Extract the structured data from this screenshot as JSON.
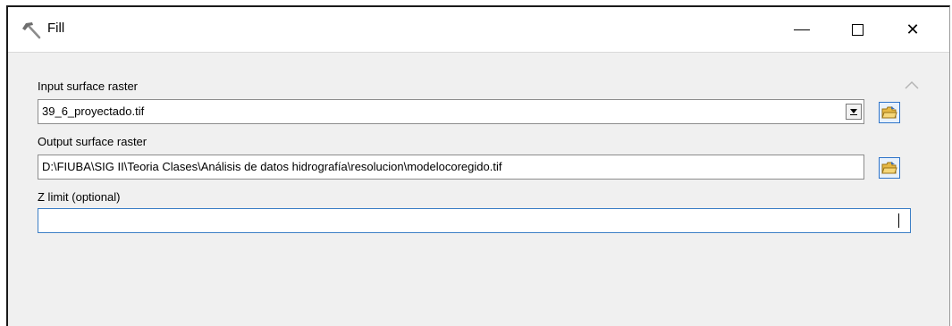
{
  "window": {
    "title": "Fill",
    "title_icon": "hammer-icon",
    "controls": {
      "minimize_icon": "minimize-icon",
      "maximize_icon": "maximize-icon",
      "close_glyph": "✕"
    }
  },
  "form": {
    "input_raster": {
      "label": "Input surface raster",
      "value": "39_6_proyectado.tif"
    },
    "output_raster": {
      "label": "Output surface raster",
      "value": "D:\\FIUBA\\SIG II\\Teoria Clases\\Análisis de datos hidrografía\\resolucion\\modelocoregido.tif"
    },
    "z_limit": {
      "label": "Z limit (optional)",
      "value": ""
    }
  },
  "colors": {
    "focus_border": "#3c7fc6",
    "browse_border": "#2e74c9",
    "folder": "#e6b844"
  }
}
